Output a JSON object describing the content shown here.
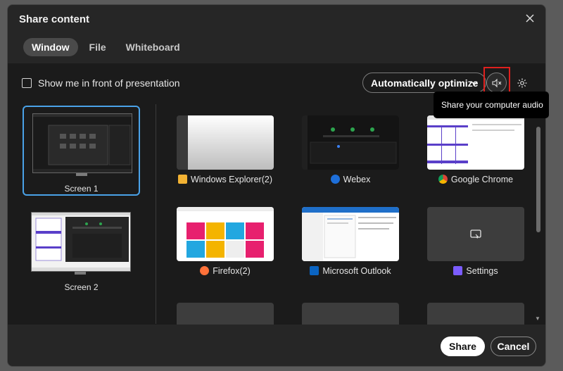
{
  "dialog": {
    "title": "Share content"
  },
  "tabs": [
    {
      "label": "Window",
      "active": true
    },
    {
      "label": "File",
      "active": false
    },
    {
      "label": "Whiteboard",
      "active": false
    }
  ],
  "options": {
    "show_me_label": "Show me in front of presentation",
    "show_me_checked": false,
    "optimize_value": "Automatically optimize",
    "audio_tooltip": "Share your computer audio"
  },
  "screens": [
    {
      "label": "Screen 1",
      "selected": true
    },
    {
      "label": "Screen 2",
      "selected": false
    }
  ],
  "apps": [
    {
      "label": "Windows Explorer(2)",
      "icon": "folder-icon"
    },
    {
      "label": "Webex",
      "icon": "webex-icon"
    },
    {
      "label": "Google Chrome",
      "icon": "chrome-icon"
    },
    {
      "label": "Firefox(2)",
      "icon": "firefox-icon"
    },
    {
      "label": "Microsoft Outlook",
      "icon": "outlook-icon"
    },
    {
      "label": "Settings",
      "icon": "gear-icon"
    }
  ],
  "footer": {
    "share_label": "Share",
    "cancel_label": "Cancel"
  },
  "colors": {
    "accent_selected": "#4aa2e8",
    "highlight_box": "#e0201e",
    "settings_icon": "#7b5cff"
  }
}
